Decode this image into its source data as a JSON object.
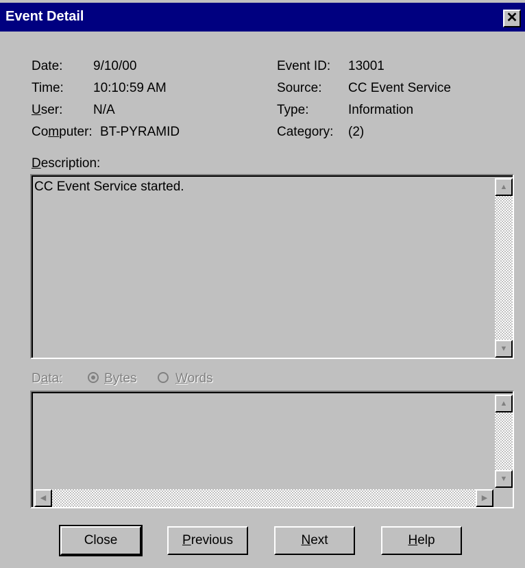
{
  "window": {
    "title": "Event Detail",
    "close_glyph": "✕"
  },
  "fields": {
    "date_label": "Date:",
    "date_value": "9/10/00",
    "time_label": "Time:",
    "time_value": "10:10:59 AM",
    "user_label_u": "U",
    "user_label_rest": "ser:",
    "user_value": "N/A",
    "computer_label_pre": "Co",
    "computer_label_u": "m",
    "computer_label_rest": "puter:",
    "computer_value": "BT-PYRAMID",
    "event_id_label": "Event ID:",
    "event_id_value": "13001",
    "source_label": "Source:",
    "source_value": "CC Event Service",
    "type_label": "Type:",
    "type_value": "Information",
    "category_label": "Category:",
    "category_value": "(2)"
  },
  "description": {
    "label_u": "D",
    "label_rest": "escription:",
    "text": "CC Event Service started."
  },
  "data_section": {
    "label_pre": "D",
    "label_u": "a",
    "label_rest": "ta:",
    "bytes_u": "B",
    "bytes_rest": "ytes",
    "words_u": "W",
    "words_rest": "ords",
    "selected": "Bytes"
  },
  "buttons": {
    "close": "Close",
    "previous_u": "P",
    "previous_rest": "revious",
    "next_u": "N",
    "next_rest": "ext",
    "help_u": "H",
    "help_rest": "elp"
  }
}
